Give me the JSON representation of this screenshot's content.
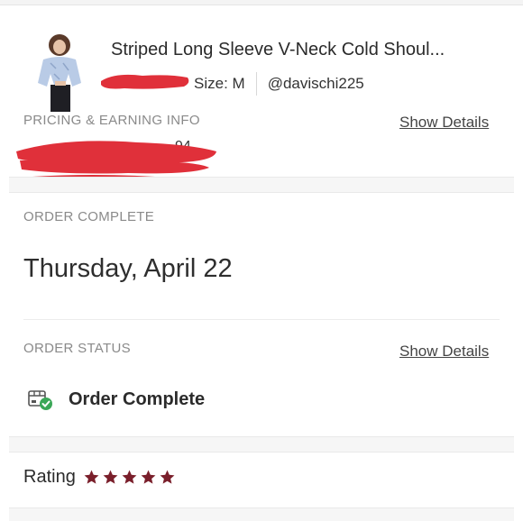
{
  "product": {
    "title": "Striped Long Sleeve V-Neck Cold Shoul...",
    "size": "Size: M",
    "seller": "@davischi225"
  },
  "pricing": {
    "label": "PRICING & EARNING INFO",
    "show_details": "Show Details",
    "value_visible": "94"
  },
  "order_complete": {
    "label": "ORDER COMPLETE",
    "date": "Thursday, April 22"
  },
  "order_status": {
    "label": "ORDER STATUS",
    "show_details": "Show Details",
    "status": "Order Complete"
  },
  "rating": {
    "label": "Rating",
    "stars": 5,
    "star_color": "#7a1f2b"
  },
  "colors": {
    "redaction": "#e0303a",
    "check_green": "#3aa757"
  }
}
